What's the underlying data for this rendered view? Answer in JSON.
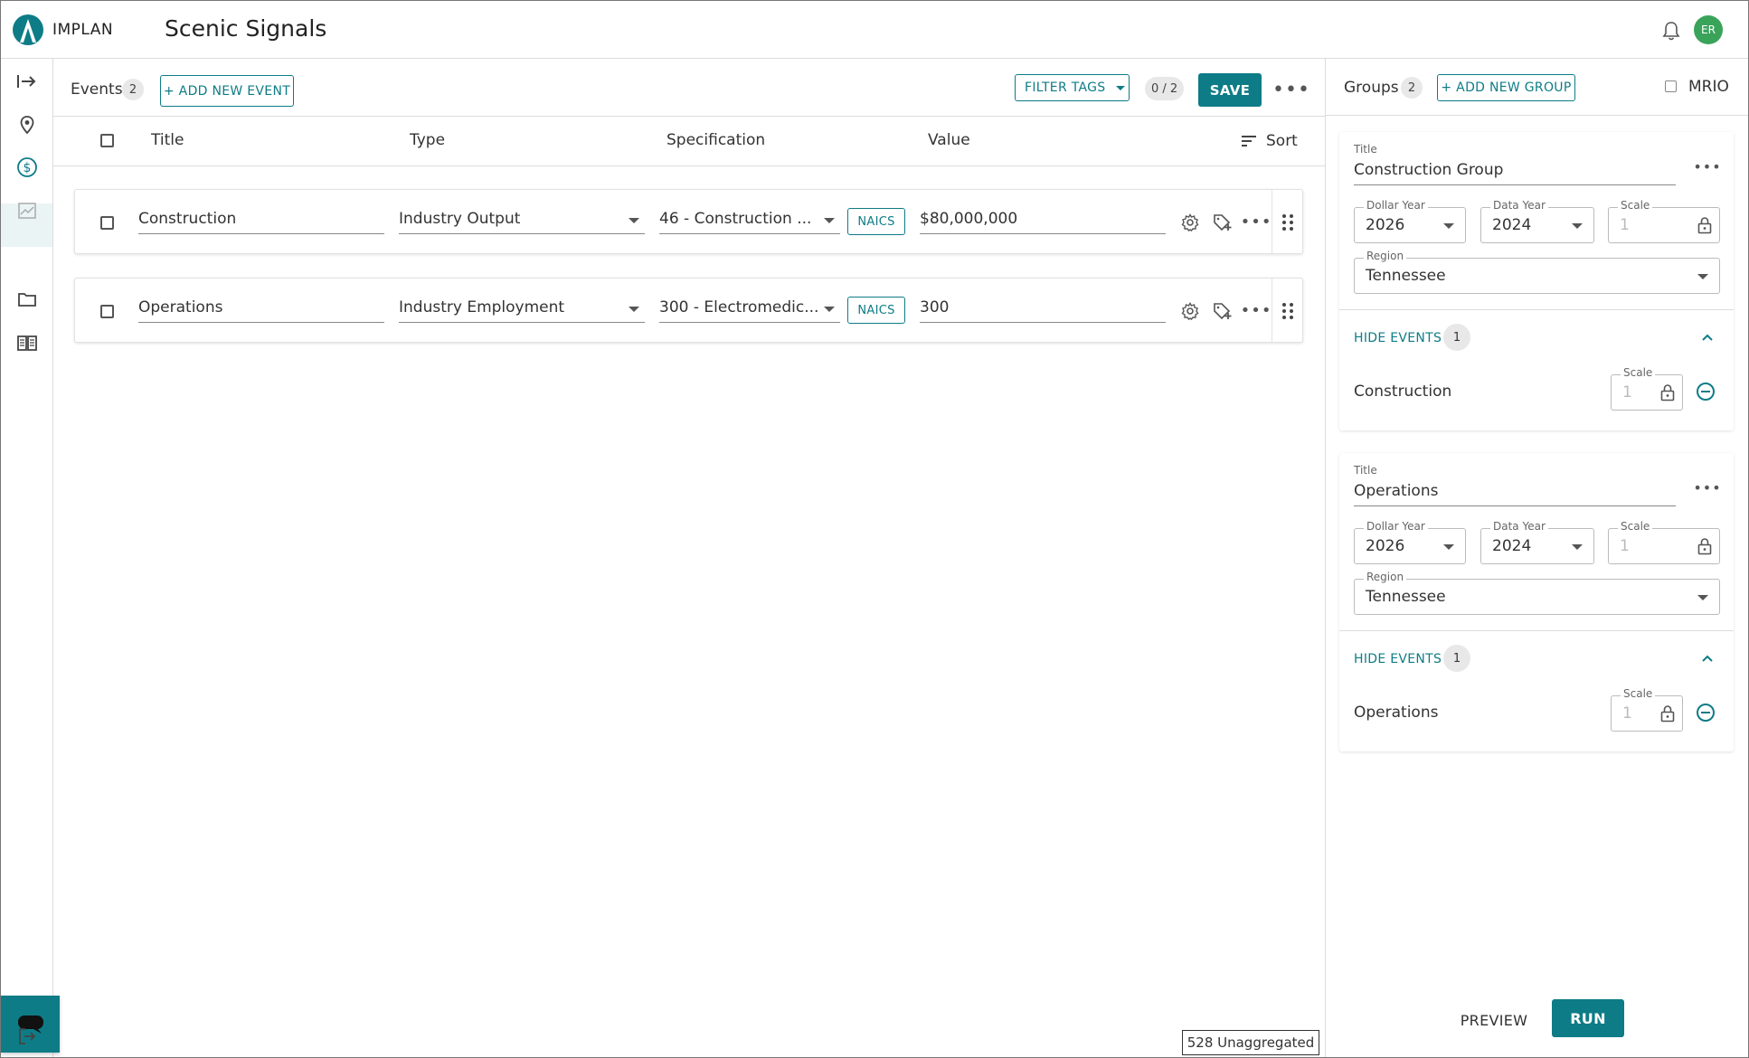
{
  "header": {
    "logo_text": "IMPLAN",
    "project_title": "Scenic Signals",
    "avatar_initials": "ER"
  },
  "sidebar": {
    "icons": [
      "expand-icon",
      "map-pin-icon",
      "dollar-icon",
      "chart-icon",
      "folder-icon",
      "book-icon",
      "logout-icon"
    ],
    "active": "dollar-icon"
  },
  "events": {
    "label": "Events",
    "count": "2",
    "add_button": "+ ADD NEW EVENT",
    "filter_tags": "FILTER TAGS",
    "selected_counter": "0 / 2",
    "save_button": "SAVE",
    "columns": {
      "title": "Title",
      "type": "Type",
      "specification": "Specification",
      "value": "Value",
      "sort": "Sort"
    },
    "rows": [
      {
        "title": "Construction",
        "type": "Industry Output",
        "specification": "46 - Construction ...",
        "spec_badge": "NAICS",
        "value": "$80,000,000"
      },
      {
        "title": "Operations",
        "type": "Industry Employment",
        "specification": "300 - Electromedic...",
        "spec_badge": "NAICS",
        "value": "300"
      }
    ]
  },
  "groups": {
    "label": "Groups",
    "count": "2",
    "add_button": "+ ADD NEW GROUP",
    "mrio_label": "MRIO",
    "field_labels": {
      "title": "Title",
      "dollar_year": "Dollar Year",
      "data_year": "Data Year",
      "scale": "Scale",
      "region": "Region"
    },
    "items": [
      {
        "title": "Construction Group",
        "dollar_year": "2026",
        "data_year": "2024",
        "scale": "1",
        "region": "Tennessee",
        "hide_events": "HIDE EVENTS",
        "event_count": "1",
        "event_name": "Construction",
        "event_scale": "1"
      },
      {
        "title": "Operations",
        "dollar_year": "2026",
        "data_year": "2024",
        "scale": "1",
        "region": "Tennessee",
        "hide_events": "HIDE EVENTS",
        "event_count": "1",
        "event_name": "Operations",
        "event_scale": "1"
      }
    ]
  },
  "footer": {
    "status": "528 Unaggregated",
    "preview_button": "PREVIEW",
    "run_button": "RUN"
  },
  "colors": {
    "accent": "#0e7c86",
    "avatar": "#3aa35a"
  }
}
